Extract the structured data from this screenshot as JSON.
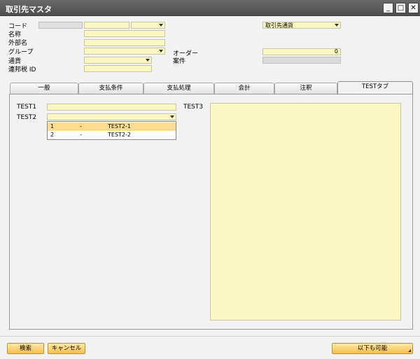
{
  "window": {
    "title": "取引先マスタ",
    "minimize_glyph": "_",
    "maximize_glyph": "□",
    "close_glyph": "✕"
  },
  "header": {
    "code_label": "コード",
    "name_label": "名称",
    "foreign_name_label": "外部名",
    "group_label": "グループ",
    "currency_label": "通貨",
    "federal_tax_label": "連邦税 ID",
    "order_label": "オーダー",
    "order_value": "0",
    "project_label": "案件",
    "currency_type_value": "取引先通貨"
  },
  "tabs": [
    {
      "label": "一般"
    },
    {
      "label": "支払条件"
    },
    {
      "label": "支払処理"
    },
    {
      "label": "会計"
    },
    {
      "label": "注釈"
    },
    {
      "label": "TESTタブ"
    }
  ],
  "active_tab": "TESTタブ",
  "test_tab": {
    "test1_label": "TEST1",
    "test2_label": "TEST2",
    "test3_label": "TEST3",
    "test2_options": [
      {
        "code": "1",
        "sep": "-",
        "name": "TEST2-1",
        "selected": true
      },
      {
        "code": "2",
        "sep": "-",
        "name": "TEST2-2",
        "selected": false
      }
    ]
  },
  "footer": {
    "search_button": "検索",
    "cancel_button": "キャンセル",
    "copy_button": "以下も可能"
  },
  "colors": {
    "field_yellow": "#fbf7c2",
    "button_orange": "#f5c04a",
    "selected_row": "#fbdc8c",
    "titlebar": "#5a5a5a"
  }
}
